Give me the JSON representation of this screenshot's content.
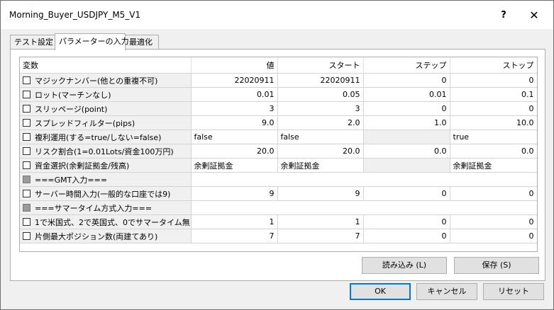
{
  "window": {
    "title": "Morning_Buyer_USDJPY_M5_V1",
    "help": "?",
    "close": "✕"
  },
  "tabs": [
    {
      "label": "テスト設定"
    },
    {
      "label": "パラメーターの入力"
    },
    {
      "label": "最適化"
    }
  ],
  "grid": {
    "headers": {
      "variable": "変数",
      "value": "値",
      "start": "スタート",
      "step": "ステップ",
      "stop": "ストップ"
    },
    "rows": [
      {
        "name": "マジックナンバー(他との重複不可)",
        "value": "22020911",
        "start": "22020911",
        "step": "0",
        "stop": "0"
      },
      {
        "name": "ロット(マーチンなし)",
        "value": "0.01",
        "start": "0.05",
        "step": "0.01",
        "stop": "0.1"
      },
      {
        "name": "スリッページ(point)",
        "value": "3",
        "start": "3",
        "step": "0",
        "stop": "0"
      },
      {
        "name": "スプレッドフィルター(pips)",
        "value": "9.0",
        "start": "2.0",
        "step": "1.0",
        "stop": "10.0"
      },
      {
        "name": "複利運用(する=true/しない=false)",
        "value": "false",
        "start": "false",
        "step": "",
        "stop": "true"
      },
      {
        "name": "リスク割合(1=0.01Lots/資金100万円)",
        "value": "20.0",
        "start": "20.0",
        "step": "0.0",
        "stop": "0.0"
      },
      {
        "name": "資金選択(余剰証拠金/残高)",
        "value": "余剰証拠金",
        "start": "余剰証拠金",
        "step": "",
        "stop": "余剰証拠金"
      },
      {
        "name": "===GMT入力==="
      },
      {
        "name": "サーバー時間入力(一般的な口座では9)",
        "value": "9",
        "start": "9",
        "step": "0",
        "stop": "0"
      },
      {
        "name": "===サマータイム方式入力==="
      },
      {
        "name": "1で米国式、2で英国式、0でサマータイム無し",
        "value": "1",
        "start": "1",
        "step": "0",
        "stop": "0"
      },
      {
        "name": "片側最大ポジション数(両建てあり)",
        "value": "7",
        "start": "7",
        "step": "0",
        "stop": "0"
      }
    ]
  },
  "buttons": {
    "load": "読み込み (L)",
    "save": "保存 (S)",
    "ok": "OK",
    "cancel": "キャンセル",
    "reset": "リセット"
  }
}
